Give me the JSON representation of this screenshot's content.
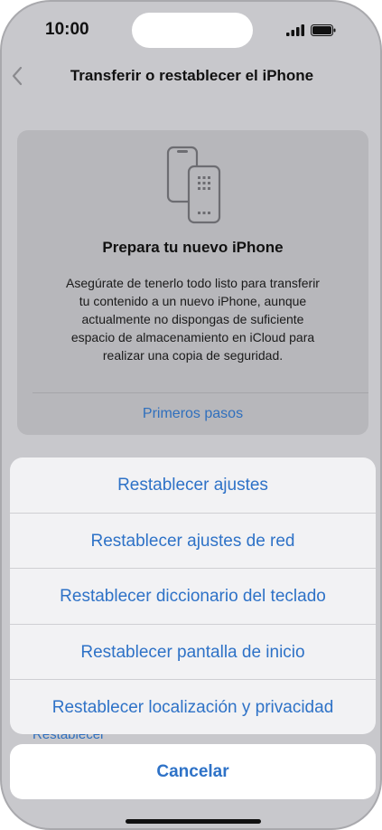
{
  "status_bar": {
    "time": "10:00",
    "signal_icon": "cellular-signal-icon",
    "battery_icon": "battery-icon"
  },
  "nav": {
    "back_icon": "chevron-left-icon",
    "title": "Transferir o restablecer el iPhone"
  },
  "card": {
    "icon": "phone-transfer-icon",
    "title": "Prepara tu nuevo iPhone",
    "body_lines": [
      "Asegúrate de tenerlo todo listo para transferir",
      "tu contenido a un nuevo iPhone, aunque",
      "actualmente no dispongas de suficiente",
      "espacio de almacenamiento en iCloud para",
      "realizar una copia de seguridad."
    ],
    "link": "Primeros pasos"
  },
  "background_peek_label": "Restablecer",
  "action_sheet": {
    "items": [
      "Restablecer ajustes",
      "Restablecer ajustes de red",
      "Restablecer diccionario del teclado",
      "Restablecer pantalla de inicio",
      "Restablecer localización y privacidad"
    ],
    "cancel": "Cancelar"
  },
  "colors": {
    "accent": "#2e72c7",
    "dim_background": "#c8c8cc",
    "sheet_background": "#f2f2f4"
  }
}
